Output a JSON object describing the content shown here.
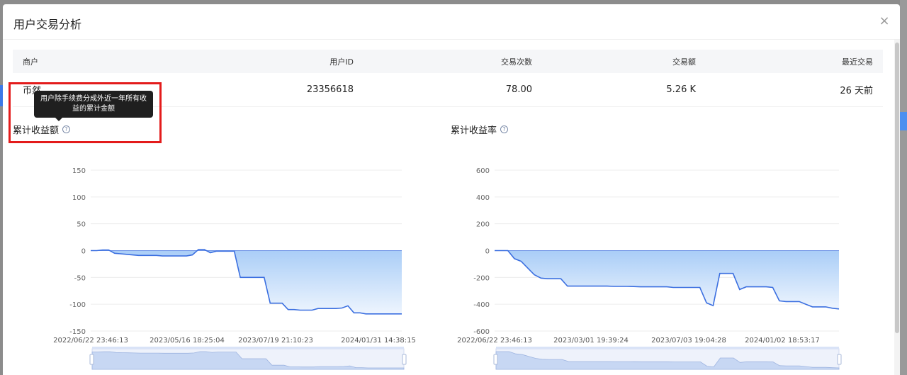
{
  "modal": {
    "title": "用户交易分析",
    "close_label": "×"
  },
  "table": {
    "headers": [
      "商户",
      "用户ID",
      "交易次数",
      "交易额",
      "最近交易"
    ],
    "row": [
      "币然",
      "23356618",
      "78.00",
      "5.26 K",
      "26 天前"
    ]
  },
  "tooltip": {
    "line1": "用户除手续费分成外近一年所有收",
    "line2": "益的累计金额"
  },
  "help_icon_glyph": "?",
  "colors": {
    "line": "#3b6fe0",
    "area_top": "#a9cdf7",
    "area_bottom": "#eef5fe",
    "highlight": "#e31b1b"
  },
  "chart_data": [
    {
      "type": "area",
      "title": "累计收益额",
      "y_ticks": [
        150,
        100,
        50,
        0,
        -50,
        -100,
        -150
      ],
      "ylim": [
        -150,
        150
      ],
      "x_ticks": [
        "2022/06/22 23:46:13",
        "2023/05/16 18:25:04",
        "2023/07/19 21:10:23",
        "2024/01/31 14:38:15"
      ],
      "grid": true,
      "has_zoom_slider": true,
      "values": [
        0,
        0,
        1,
        1,
        -5,
        -6,
        -7,
        -8,
        -9,
        -9,
        -9,
        -9,
        -10,
        -10,
        -10,
        -10,
        -10,
        -8,
        2,
        2,
        -4,
        -1,
        -1,
        -1,
        -1,
        -50,
        -50,
        -50,
        -50,
        -50,
        -98,
        -98,
        -98,
        -110,
        -110,
        -111,
        -111,
        -111,
        -108,
        -108,
        -108,
        -108,
        -107,
        -103,
        -116,
        -116,
        -118,
        -118,
        -118,
        -118,
        -118,
        -118,
        -118
      ]
    },
    {
      "type": "area",
      "title": "累计收益率",
      "y_ticks": [
        600,
        400,
        200,
        0,
        -200,
        -400,
        -600
      ],
      "ylim": [
        -600,
        600
      ],
      "x_ticks": [
        "2022/06/22 23:46:13",
        "2023/03/01 19:39:24",
        "2023/07/03 19:04:28",
        "2024/01/02 18:53:17"
      ],
      "grid": true,
      "has_zoom_slider": true,
      "values": [
        0,
        0,
        0,
        -60,
        -80,
        -130,
        -180,
        -205,
        -210,
        -210,
        -210,
        -265,
        -265,
        -265,
        -265,
        -265,
        -265,
        -265,
        -267,
        -267,
        -267,
        -268,
        -270,
        -270,
        -270,
        -270,
        -270,
        -275,
        -275,
        -275,
        -275,
        -275,
        -390,
        -410,
        -170,
        -170,
        -170,
        -290,
        -270,
        -270,
        -270,
        -270,
        -275,
        -375,
        -380,
        -380,
        -380,
        -400,
        -420,
        -420,
        -420,
        -430,
        -435
      ]
    }
  ]
}
